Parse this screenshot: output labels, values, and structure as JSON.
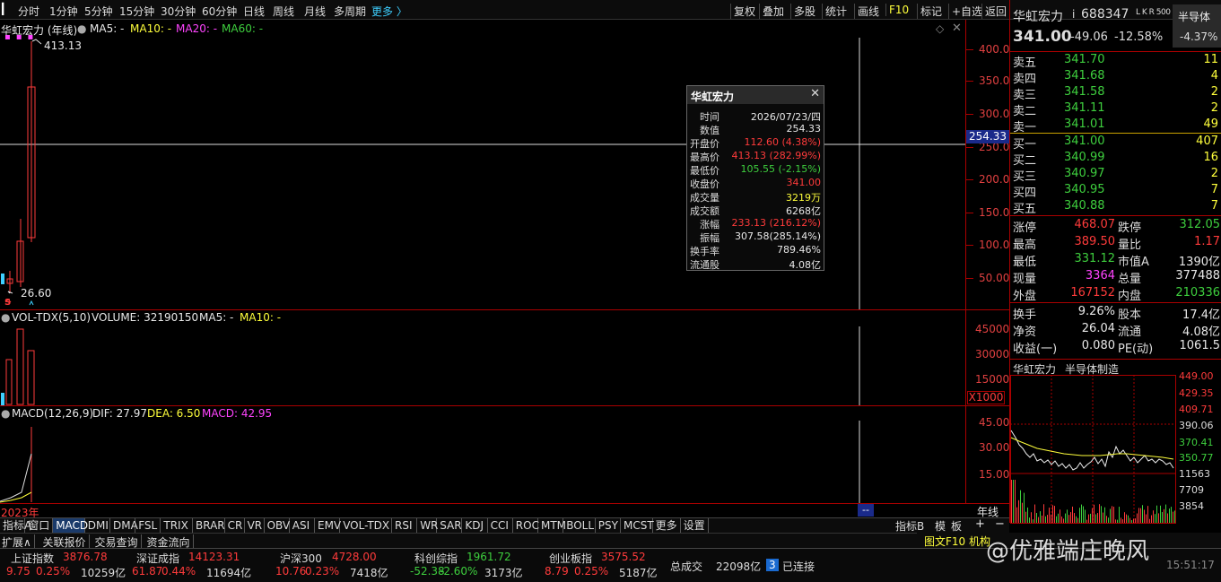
{
  "topbar": {
    "periods": [
      "分时",
      "1分钟",
      "5分钟",
      "15分钟",
      "30分钟",
      "60分钟",
      "日线",
      "周线",
      "月线",
      "多周期",
      "更多 〉"
    ],
    "tools": [
      "复权",
      "叠加",
      "多股",
      "统计",
      "画线",
      "F10",
      "标记",
      "+自选",
      "返回"
    ]
  },
  "main": {
    "title": "华虹宏力 (年线)",
    "ma5": "MA5: -",
    "ma10": "MA10: -",
    "ma20": "MA20: -",
    "ma60": "MA60: -",
    "high_label": "413.13",
    "low_label": "26.60",
    "axis": [
      "400.0",
      "350.0",
      "300.0",
      "250.0",
      "200.0",
      "150.0",
      "100.0",
      "50.00"
    ],
    "cursor_value": "254.33",
    "s_mark": "S"
  },
  "vol": {
    "title": "VOL-TDX(5,10)",
    "volume": "VOLUME: 32190150",
    "ma5": "MA5: -",
    "ma10": "MA10: -",
    "axis": [
      "45000",
      "30000",
      "15000"
    ],
    "unit": "X1000"
  },
  "macd": {
    "title": "MACD(12,26,9)",
    "dif": "DIF: 27.97",
    "dea": "DEA: 6.50",
    "macd": "MACD: 42.95",
    "axis": [
      "45.00",
      "30.00",
      "15.00"
    ],
    "year_label": "2023年",
    "period_label": "年线",
    "cursor_tag": "--"
  },
  "tooltip": {
    "title": "华虹宏力",
    "rows": [
      {
        "k": "时间",
        "v": "2026/07/23/四",
        "c": "#e8e8e8"
      },
      {
        "k": "数值",
        "v": "254.33",
        "c": "#e8e8e8"
      },
      {
        "k": "开盘价",
        "v": "112.60 (4.38%)",
        "c": "#ff3b3b"
      },
      {
        "k": "最高价",
        "v": "413.13 (282.99%)",
        "c": "#ff3b3b"
      },
      {
        "k": "最低价",
        "v": "105.55 (-2.15%)",
        "c": "#3ecf3e"
      },
      {
        "k": "收盘价",
        "v": "341.00",
        "c": "#ff3b3b"
      },
      {
        "k": "成交量",
        "v": "3219万",
        "c": "#ffff3b"
      },
      {
        "k": "成交额",
        "v": "6268亿",
        "c": "#e8e8e8"
      },
      {
        "k": "涨幅",
        "v": "233.13 (216.12%)",
        "c": "#ff3b3b"
      },
      {
        "k": "振幅",
        "v": "307.58(285.14%)",
        "c": "#e8e8e8"
      },
      {
        "k": "换手率",
        "v": "789.46%",
        "c": "#e8e8e8"
      },
      {
        "k": "流通股",
        "v": "4.08亿",
        "c": "#e8e8e8"
      }
    ]
  },
  "indicator_tabs": [
    "指标A",
    "窗口",
    "MACD",
    "DMI",
    "DMA",
    "FSL",
    "TRIX",
    "BRAR",
    "CR",
    "VR",
    "OBV",
    "ASI",
    "EMV",
    "VOL-TDX",
    "RSI",
    "WR",
    "SAR",
    "KDJ",
    "CCI",
    "ROC",
    "MTM",
    "BOLL",
    "PSY",
    "MCST",
    "更多",
    "设置"
  ],
  "indicator_right": [
    "指标B",
    "模",
    "板"
  ],
  "ext_tabs": [
    "扩展∧",
    "关联报价",
    "交易查询",
    "资金流向"
  ],
  "quote": {
    "name": "华虹宏力",
    "info_icon": "i",
    "code": "688347",
    "tags": "L K R 500",
    "sector": "半导体",
    "price": "341.00",
    "change": "-49.06",
    "change_pct": "-12.58%",
    "sector_pct": "-4.37%",
    "asks": [
      {
        "l": "卖五",
        "p": "341.70",
        "q": "11"
      },
      {
        "l": "卖四",
        "p": "341.68",
        "q": "4"
      },
      {
        "l": "卖三",
        "p": "341.58",
        "q": "2"
      },
      {
        "l": "卖二",
        "p": "341.11",
        "q": "2"
      },
      {
        "l": "卖一",
        "p": "341.01",
        "q": "49"
      }
    ],
    "bids": [
      {
        "l": "买一",
        "p": "341.00",
        "q": "407"
      },
      {
        "l": "买二",
        "p": "340.99",
        "q": "16"
      },
      {
        "l": "买三",
        "p": "340.97",
        "q": "2"
      },
      {
        "l": "买四",
        "p": "340.95",
        "q": "7"
      },
      {
        "l": "买五",
        "p": "340.88",
        "q": "7"
      }
    ],
    "stats1": [
      {
        "l1": "涨停",
        "v1": "468.07",
        "c1": "#ff3b3b",
        "l2": "跌停",
        "v2": "312.05",
        "c2": "#3ecf3e"
      },
      {
        "l1": "最高",
        "v1": "389.50",
        "c1": "#ff3b3b",
        "l2": "量比",
        "v2": "1.17",
        "c2": "#ff3b3b"
      },
      {
        "l1": "最低",
        "v1": "331.12",
        "c1": "#3ecf3e",
        "l2": "市值A",
        "v2": "1390亿",
        "c2": "#e8e8e8"
      },
      {
        "l1": "现量",
        "v1": "3364",
        "c1": "#ff44ff",
        "l2": "总量",
        "v2": "377488",
        "c2": "#e8e8e8"
      },
      {
        "l1": "外盘",
        "v1": "167152",
        "c1": "#ff3b3b",
        "l2": "内盘",
        "v2": "210336",
        "c2": "#3ecf3e"
      }
    ],
    "stats2": [
      {
        "l1": "换手",
        "v1": "9.26%",
        "l2": "股本",
        "v2": "17.4亿"
      },
      {
        "l1": "净资",
        "v1": "26.04",
        "l2": "流通",
        "v2": "4.08亿"
      },
      {
        "l1": "收益(一)",
        "v1": "0.080",
        "l2": "PE(动)",
        "v2": "1061.5"
      }
    ]
  },
  "mini": {
    "name": "华虹宏力",
    "industry": "半导体制造",
    "axis": [
      "449.00",
      "429.35",
      "409.71",
      "390.06",
      "370.41",
      "350.77",
      "11563",
      "7709",
      "3854"
    ]
  },
  "bottombar": {
    "indices": [
      {
        "name": "上证指数",
        "val": "3876.78",
        "chg": "9.75",
        "pct": "0.25%",
        "amt": "10259亿",
        "color": "#ff3b3b"
      },
      {
        "name": "深证成指",
        "val": "14123.31",
        "chg": "61.87",
        "pct": "0.44%",
        "amt": "11694亿",
        "color": "#ff3b3b"
      },
      {
        "name": "沪深300",
        "val": "4728.00",
        "chg": "10.76",
        "pct": "0.23%",
        "amt": "7418亿",
        "color": "#ff3b3b"
      },
      {
        "name": "科创综指",
        "val": "1961.72",
        "chg": "-52.38",
        "pct": "-2.60%",
        "amt": "3173亿",
        "color": "#3ecf3e"
      },
      {
        "name": "创业板指",
        "val": "3575.52",
        "chg": "8.79",
        "pct": "0.25%",
        "amt": "5187亿",
        "color": "#ff3b3b"
      }
    ],
    "total_label": "总成交",
    "total": "22098亿",
    "conn_count": "3",
    "conn": "已连接",
    "time": "15:51:17",
    "right_tabs": [
      "图文F10",
      "机构"
    ]
  },
  "watermark": "@优雅端庄晚风"
}
